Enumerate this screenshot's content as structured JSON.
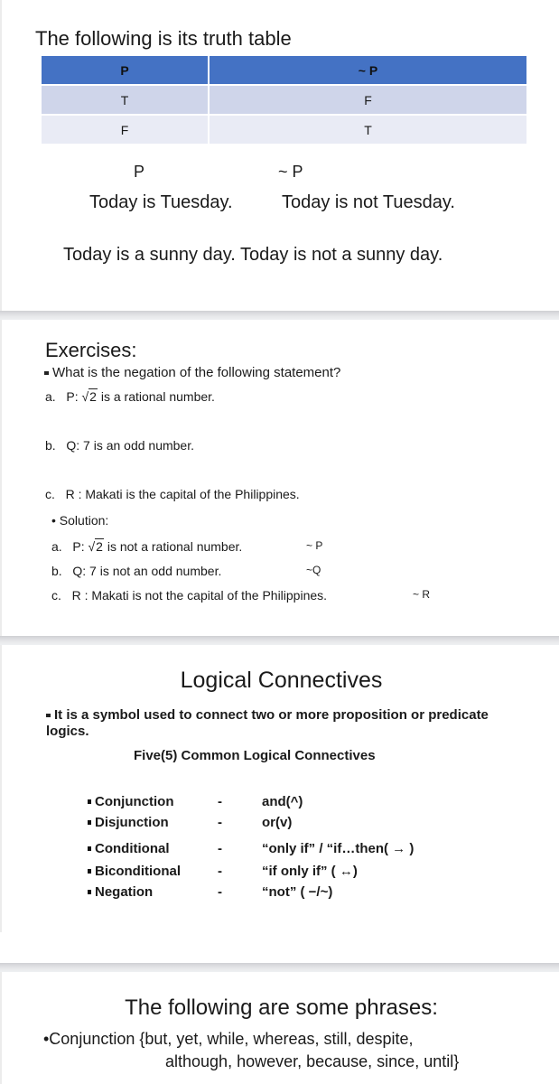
{
  "slide1": {
    "title": "The following is its truth table",
    "truth_table": {
      "headers": [
        "P",
        "~ P"
      ],
      "rows": [
        [
          "T",
          "F"
        ],
        [
          "F",
          "T"
        ]
      ]
    },
    "colors": {
      "header": "#4472c4",
      "row_odd": "#cfd5ea",
      "row_even": "#e9ebf5"
    },
    "labels": {
      "p": "P",
      "not_p": "~ P"
    },
    "example1": {
      "p": "Today is Tuesday.",
      "not_p": "Today is not Tuesday."
    },
    "example2": "Today is a sunny day.  Today is not a sunny day."
  },
  "slide2": {
    "title": "Exercises:",
    "question": "What is the negation of the following statement?",
    "items": [
      {
        "letter": "a.",
        "prefix": "P:",
        "radical": "2",
        "text": "is a rational number."
      },
      {
        "letter": "b.",
        "text": "Q: 7 is an odd number."
      },
      {
        "letter": "c.",
        "text": "R : Makati is the capital of the Philippines."
      }
    ],
    "solution_label": "Solution:",
    "solutions": [
      {
        "letter": "a.",
        "prefix": "P:",
        "radical": "2",
        "text": "is not a rational number.",
        "symbol": "~ P"
      },
      {
        "letter": "b.",
        "text": "Q: 7 is not an odd number.",
        "symbol": "~Q"
      },
      {
        "letter": "c.",
        "text": "R : Makati is not the capital of the Philippines.",
        "symbol": "~ R"
      }
    ]
  },
  "slide3": {
    "title": "Logical Connectives",
    "definition": "It is a symbol used to connect two or more proposition or predicate logics.",
    "subtitle": "Five(5) Common Logical Connectives",
    "connectives": [
      {
        "name": "Conjunction",
        "dash": "-",
        "value": "and(^)"
      },
      {
        "name": "Disjunction",
        "dash": "-",
        "value": "or(v)"
      },
      {
        "name": "Conditional",
        "dash": "-",
        "value": "“only if” / “if…then( → )"
      },
      {
        "name": "Biconditional",
        "dash": "-",
        "value": "“if only if” ( ↔)"
      },
      {
        "name": "Negation",
        "dash": "-",
        "value": "“not” ( −/~)"
      }
    ]
  },
  "slide4": {
    "title": "The following are some phrases:",
    "line1": "•Conjunction {but, yet, while, whereas, still, despite,",
    "line2": "although, however, because, since, until}"
  }
}
